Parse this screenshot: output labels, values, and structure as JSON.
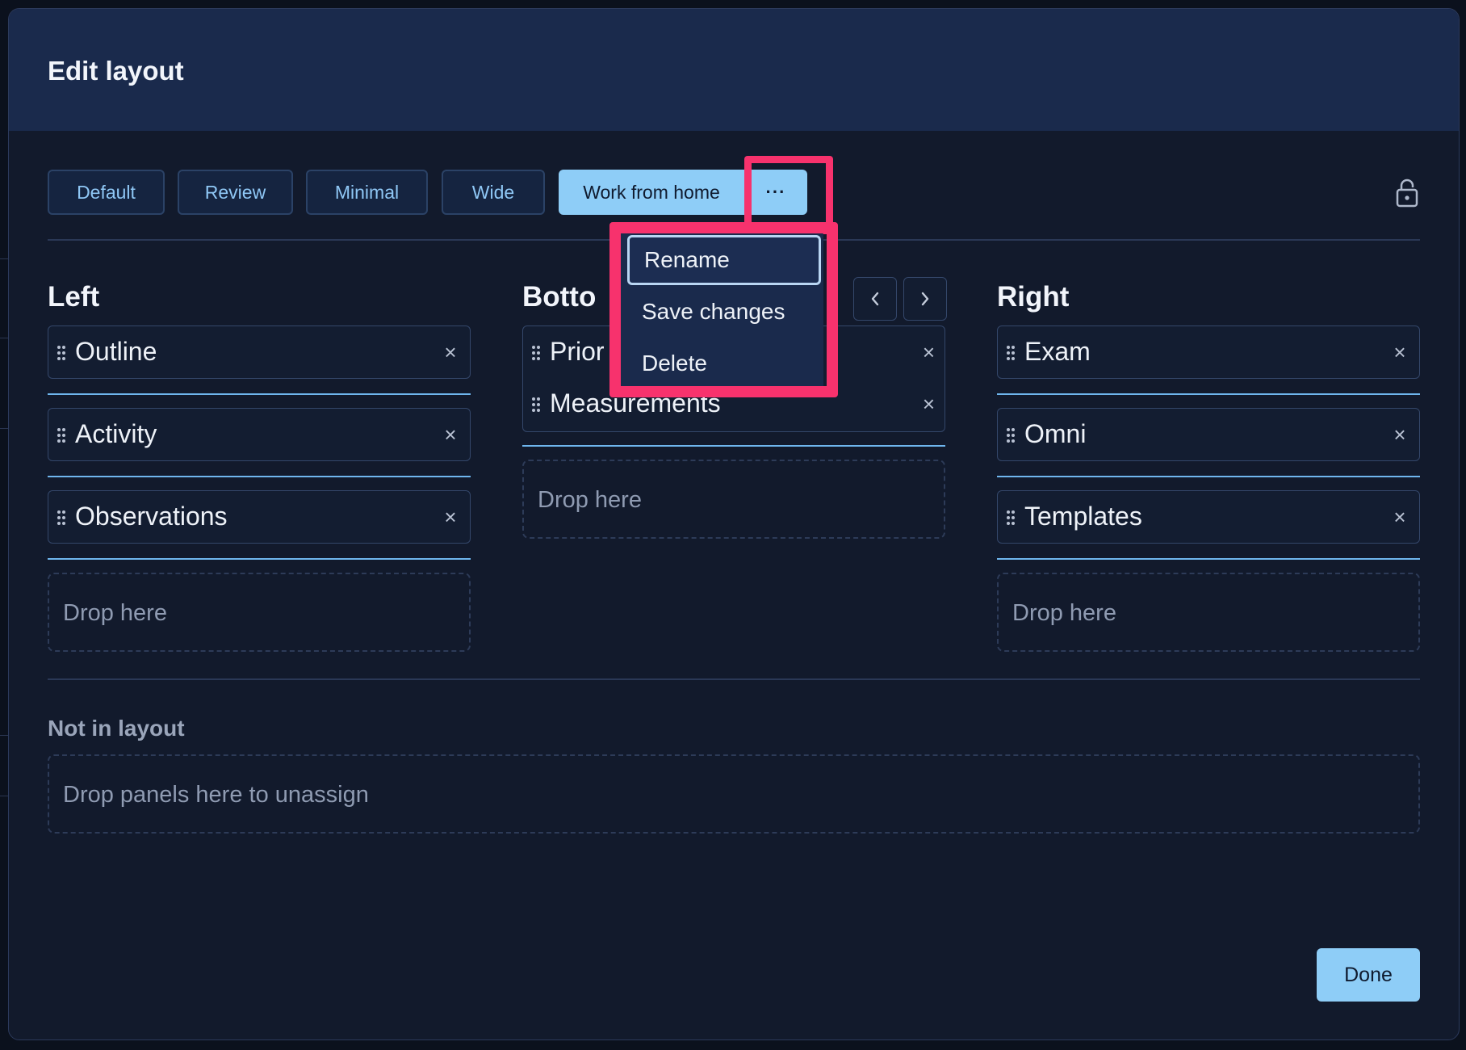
{
  "modal": {
    "title": "Edit layout"
  },
  "presets": [
    {
      "label": "Default"
    },
    {
      "label": "Review"
    },
    {
      "label": "Minimal"
    },
    {
      "label": "Wide"
    },
    {
      "label": "Work from home",
      "active": true
    }
  ],
  "more_button": {
    "label": "···"
  },
  "dropdown": {
    "items": [
      {
        "label": "Rename",
        "focused": true
      },
      {
        "label": "Save changes"
      },
      {
        "label": "Delete"
      }
    ]
  },
  "columns": {
    "left": {
      "title": "Left",
      "items": [
        "Outline",
        "Activity",
        "Observations"
      ],
      "drop_label": "Drop here"
    },
    "bottom": {
      "title": "Botto",
      "items": [
        "Prior",
        "Measurements"
      ],
      "drop_label": "Drop here"
    },
    "right": {
      "title": "Right",
      "items": [
        "Exam",
        "Omni",
        "Templates"
      ],
      "drop_label": "Drop here"
    }
  },
  "not_in_layout": {
    "title": "Not in layout",
    "drop_label": "Drop panels here to unassign"
  },
  "done_button": {
    "label": "Done"
  },
  "icons": {
    "close": "close-icon",
    "grip": "drag-handle-icon",
    "lock": "lock-icon",
    "prev": "chevron-left-icon",
    "next": "chevron-right-icon"
  },
  "colors": {
    "accent": "#8ecdf7",
    "highlight": "#f7326d",
    "header_bg": "#1a2a4c",
    "modal_bg": "#121a2c"
  }
}
